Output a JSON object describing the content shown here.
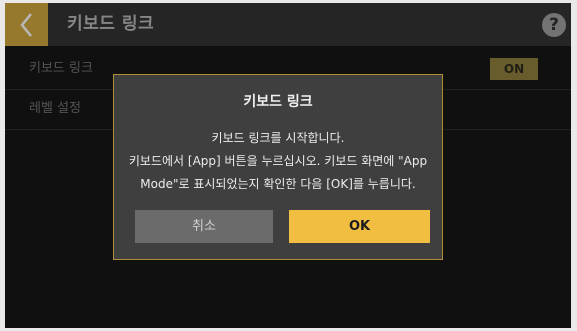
{
  "header": {
    "title": "키보드 링크",
    "back_icon": "chevron-left-icon",
    "help_label": "?"
  },
  "settings": [
    {
      "label": "키보드 링크",
      "value": "ON"
    },
    {
      "label": "레벨 설정"
    }
  ],
  "dialog": {
    "title": "키보드 링크",
    "message_line1": "키보드 링크를 시작합니다.",
    "message_line2": "키보드에서 [App] 버튼을 누르십시오. 키보드 화면에 \"App",
    "message_line3": "Mode\"로 표시되었는지 확인한 다음 [OK]를 누릅니다.",
    "cancel_label": "취소",
    "ok_label": "OK"
  },
  "colors": {
    "accent": "#f1be42",
    "header_bg": "#323232",
    "screen_bg": "#161616"
  }
}
